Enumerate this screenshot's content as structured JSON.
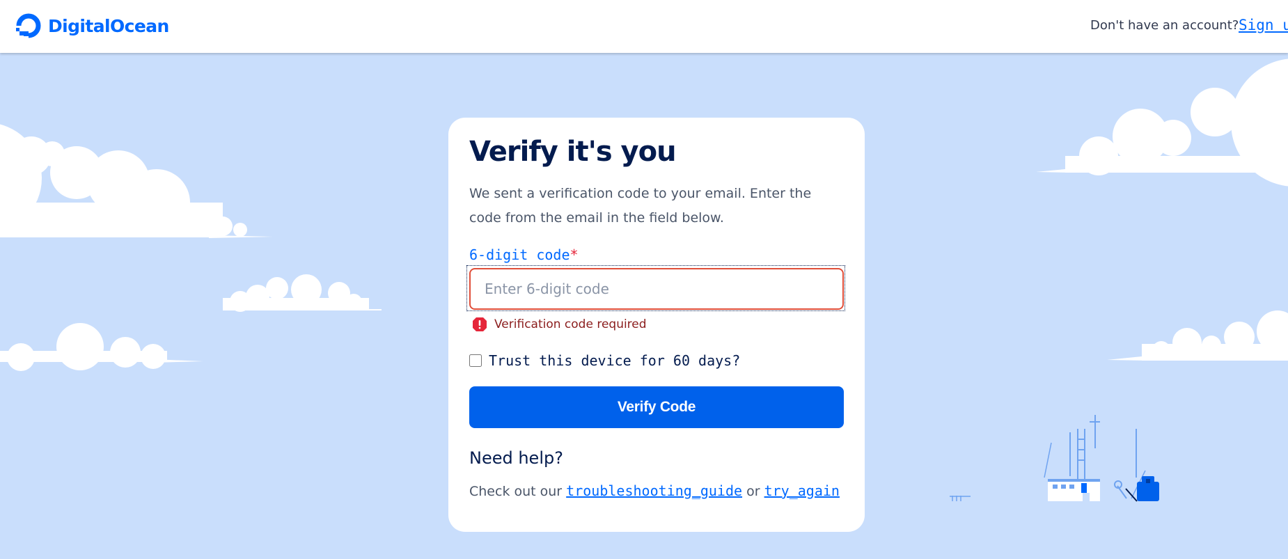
{
  "app": {
    "brand_name": "DigitalOcean",
    "brand_color": "#0069ff"
  },
  "header": {
    "account_prompt": "Don't have an account?",
    "signup_label": "Sign up"
  },
  "verify": {
    "title": "Verify it's you",
    "description": "We sent a verification code to your email. Enter the code from the email in the field below.",
    "code_label": "6-digit code",
    "required_mark": "*",
    "code_value": "",
    "code_placeholder": "Enter 6-digit code",
    "error_message": "Verification code required",
    "trust_label": "Trust this device for 60 days?",
    "trust_checked": false,
    "submit_label": "Verify Code"
  },
  "help": {
    "heading": "Need help?",
    "prefix": "Check out our",
    "guide_link": "troubleshooting_guide",
    "joiner": "or",
    "retry_link": "try_again"
  },
  "icons": {
    "logo": "digitalocean-logo-icon",
    "error": "error-alert-icon"
  },
  "colors": {
    "background": "#c9defc",
    "primary_button": "#0061eb",
    "error_border": "#e04e39",
    "error_text": "#8b1d1d",
    "heading": "#031b4e"
  }
}
